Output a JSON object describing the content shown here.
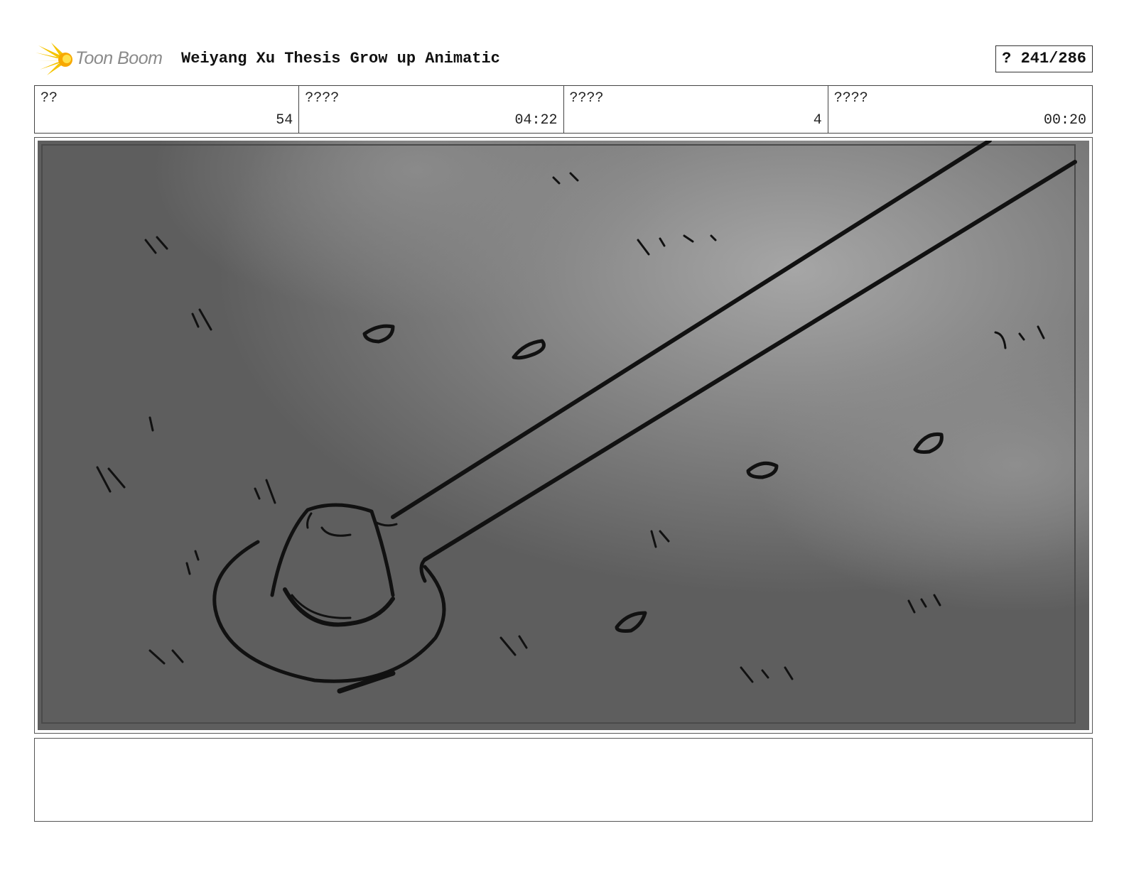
{
  "header": {
    "logo_text": "Toon Boom",
    "logo_icon": "starburst-logo-icon",
    "title": "Weiyang Xu Thesis Grow up Animatic",
    "page_indicator": "? 241/286"
  },
  "info": [
    {
      "label": "??",
      "value": "54"
    },
    {
      "label": "????",
      "value": "04:22"
    },
    {
      "label": "????",
      "value": "4"
    },
    {
      "label": "????",
      "value": "00:20"
    }
  ],
  "colors": {
    "logo_yellow": "#f5c400",
    "logo_text": "#8a8a8a",
    "panel_dark": "#5e5e5e",
    "panel_light": "#9a9a9a",
    "ink": "#111111"
  },
  "notes": {
    "text": ""
  }
}
